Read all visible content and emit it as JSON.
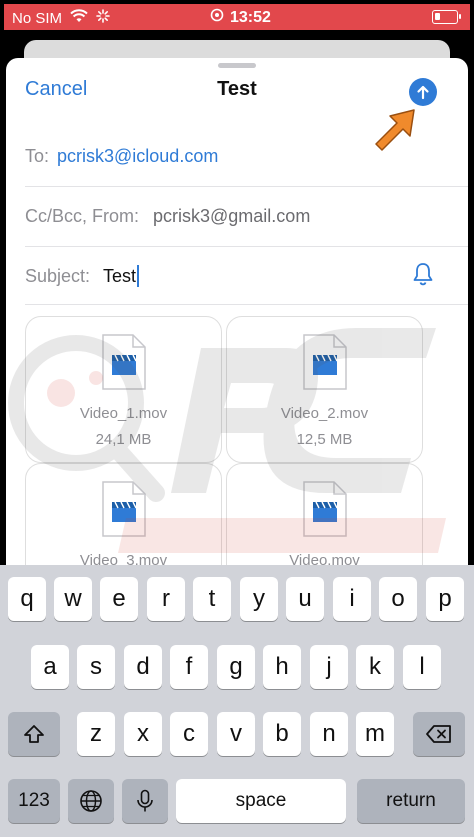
{
  "status_bar": {
    "carrier": "No SIM",
    "time": "13:52"
  },
  "compose": {
    "cancel_label": "Cancel",
    "title": "Test",
    "to_label": "To:",
    "to_value": "pcrisk3@icloud.com",
    "cc_label": "Cc/Bcc, From:",
    "from_value": "pcrisk3@gmail.com",
    "subject_label": "Subject:",
    "subject_value": "Test"
  },
  "attachments": [
    {
      "name": "Video_1.mov",
      "size": "24,1 MB"
    },
    {
      "name": "Video_2.mov",
      "size": "12,5 MB"
    },
    {
      "name": "Video_3.mov",
      "size": ""
    },
    {
      "name": "Video.mov",
      "size": ""
    }
  ],
  "keyboard": {
    "row1": [
      "q",
      "w",
      "e",
      "r",
      "t",
      "y",
      "u",
      "i",
      "o",
      "p"
    ],
    "row2": [
      "a",
      "s",
      "d",
      "f",
      "g",
      "h",
      "j",
      "k",
      "l"
    ],
    "row3": [
      "z",
      "x",
      "c",
      "v",
      "b",
      "n",
      "m"
    ],
    "numbers_label": "123",
    "space_label": "space",
    "return_label": "return"
  },
  "colors": {
    "accent": "#2f7bd6",
    "status_bar": "#e2484c",
    "pointer_arrow": "#f08a2c"
  }
}
